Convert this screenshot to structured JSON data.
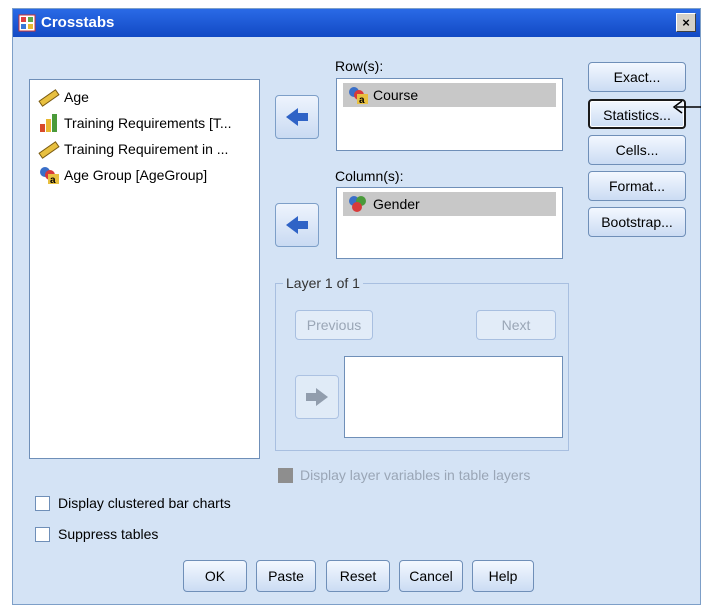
{
  "window": {
    "title": "Crosstabs",
    "close_label": "×"
  },
  "variables": [
    {
      "label": "Age",
      "icon": "ruler-scale-icon"
    },
    {
      "label": "Training Requirements [T...",
      "icon": "bar-chart-ordinal-icon"
    },
    {
      "label": "Training Requirement in ...",
      "icon": "ruler-scale-icon"
    },
    {
      "label": "Age Group [AgeGroup]",
      "icon": "nominal-string-icon"
    }
  ],
  "rows": {
    "label": "Row(s):",
    "items": [
      "Course"
    ]
  },
  "columns": {
    "label": "Column(s):",
    "items": [
      "Gender"
    ]
  },
  "layer": {
    "legend": "Layer 1 of 1",
    "previous_label": "Previous",
    "next_label": "Next",
    "display_layer_label": "Display layer variables in table layers"
  },
  "side_buttons": {
    "exact": "Exact...",
    "statistics": "Statistics...",
    "cells": "Cells...",
    "format": "Format...",
    "bootstrap": "Bootstrap..."
  },
  "options": {
    "clustered_label": "Display clustered bar charts",
    "suppress_label": "Suppress tables"
  },
  "bottom_buttons": {
    "ok": "OK",
    "paste": "Paste",
    "reset": "Reset",
    "cancel": "Cancel",
    "help": "Help"
  },
  "colors": {
    "titlebar": "#1755d6",
    "dialog_bg": "#d4e3f5",
    "arrow_blue": "#2f63c6"
  }
}
